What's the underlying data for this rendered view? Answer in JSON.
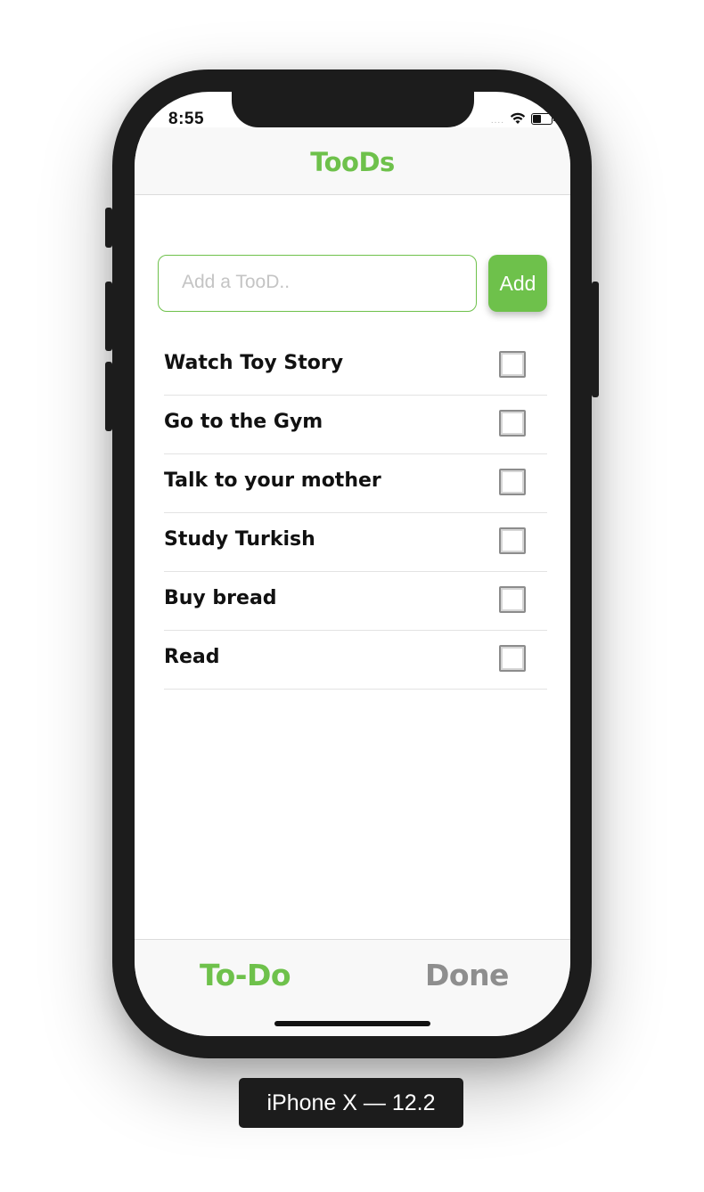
{
  "status_bar": {
    "time": "8:55",
    "signal": "....",
    "icons": [
      "wifi-icon",
      "battery-icon"
    ]
  },
  "nav": {
    "title": "TooDs"
  },
  "add_form": {
    "placeholder": "Add a TooD..",
    "value": "",
    "button_label": "Add"
  },
  "todos": [
    {
      "text": "Watch Toy Story",
      "done": false
    },
    {
      "text": "Go to the Gym",
      "done": false
    },
    {
      "text": "Talk to your mother",
      "done": false
    },
    {
      "text": "Study Turkish",
      "done": false
    },
    {
      "text": "Buy bread",
      "done": false
    },
    {
      "text": "Read",
      "done": false
    }
  ],
  "tabs": [
    {
      "label": "To-Do",
      "active": true
    },
    {
      "label": "Done",
      "active": false
    }
  ],
  "device_label": "iPhone X — 12.2",
  "colors": {
    "accent": "#6ec14b",
    "inactive_tab": "#8e8e8e",
    "frame": "#1c1c1c"
  }
}
